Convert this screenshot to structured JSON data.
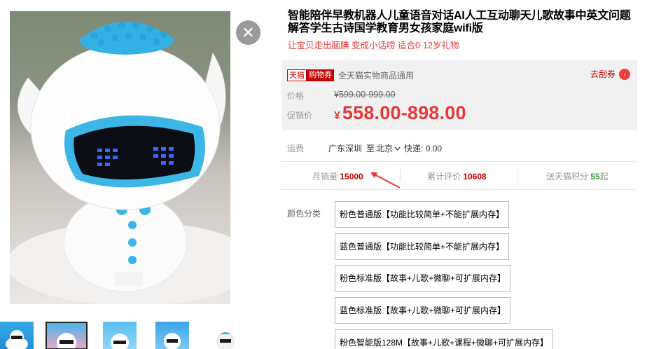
{
  "gallery": {
    "close_symbol": "✕",
    "thumbnails": [
      "thumb-1",
      "thumb-2",
      "thumb-3",
      "thumb-4",
      "thumb-5"
    ],
    "selected_thumbnail_index": 1
  },
  "product": {
    "title": "智能陪伴早教机器人儿童语音对话AI人工互动聊天儿歌故事中英文问题解答学生古诗国学教育男女孩家庭wifi版",
    "subtitle": "让宝贝走出腼腆 变成小话唠 适合0-12岁礼物"
  },
  "price_panel": {
    "badge_left": "天猫",
    "badge_right": "购物券",
    "coupon_desc": "全天猫实物商品通用",
    "get_coupon_label": "去刮券",
    "get_coupon_icon": "›",
    "price_label": "价格",
    "original_price": "¥599.00-999.00",
    "promo_label": "促销价",
    "currency_symbol": "¥",
    "promo_price": "558.00-898.00"
  },
  "shipping": {
    "label": "运费",
    "from": "广东深圳",
    "to_word": "至",
    "to_city": "北京",
    "fee": "快递: 0.00"
  },
  "stats": {
    "monthly_sales_label": "月销量",
    "monthly_sales_value": "15000",
    "reviews_label": "累计评价",
    "reviews_value": "10608",
    "points_label": "送天猫积分",
    "points_value": "55",
    "points_suffix": "起"
  },
  "options": {
    "label": "颜色分类",
    "items": [
      "粉色普通版【功能比较简单+不能扩展内存】",
      "蓝色普通版【功能比较简单+不能扩展内存】",
      "粉色标准版【故事+儿歌+微聊+可扩展内存】",
      "蓝色标准版【故事+儿歌+微聊+可扩展内存】",
      "粉色智能版128M【故事+儿歌+课程+微聊+可扩展内存】"
    ]
  },
  "colors": {
    "accent_red": "#e4393c",
    "tmall_red": "#c40000",
    "robot_blue": "#3bb6e6",
    "points_green": "#3a9a3a"
  }
}
